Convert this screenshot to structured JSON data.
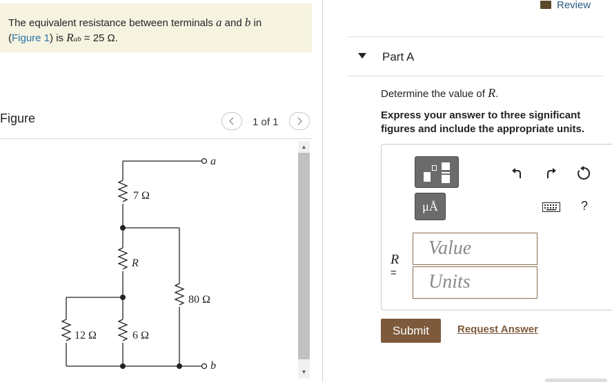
{
  "problem": {
    "text_before": "The equivalent resistance between terminals ",
    "terminal_a": "a",
    "text_and": " and ",
    "terminal_b": "b",
    "text_in": " in",
    "paren_open": "(",
    "figure_link": "Figure 1",
    "paren_close": ") is ",
    "symbol_R": "R",
    "symbol_sub": "ab",
    "value_text": " = 25 Ω."
  },
  "figure": {
    "label": "Figure",
    "page_count": "1 of 1",
    "prev_icon": "chevron-left",
    "next_icon": "chevron-right"
  },
  "circuit": {
    "labels": {
      "r1": "7 Ω",
      "r2": "R",
      "r3": "80 Ω",
      "r4": "12 Ω",
      "r5": "6 Ω",
      "terminal_a": "a",
      "terminal_b": "b"
    }
  },
  "review": {
    "label": "Review",
    "icon": "book"
  },
  "part": {
    "title": "Part A",
    "prompt_prefix": "Determine the value of ",
    "prompt_symbol": "R",
    "prompt_suffix": ".",
    "instruction": "Express your answer to three significant figures and include the appropriate units."
  },
  "toolbar": {
    "units_label": "μÅ",
    "help_label": "?",
    "icons": [
      "templates",
      "units",
      "undo",
      "redo",
      "reset",
      "keyboard",
      "help"
    ]
  },
  "answer": {
    "variable": "R",
    "equals": "=",
    "value_placeholder": "Value",
    "units_placeholder": "Units"
  },
  "actions": {
    "submit_label": "Submit",
    "request_label": "Request Answer"
  },
  "colors": {
    "problem_bg": "#f6f3e1",
    "link": "#2874a6",
    "submit_bg": "#7d5a3c",
    "toolbar_bg": "#6b6b6b",
    "input_border": "#8a6d4f"
  }
}
